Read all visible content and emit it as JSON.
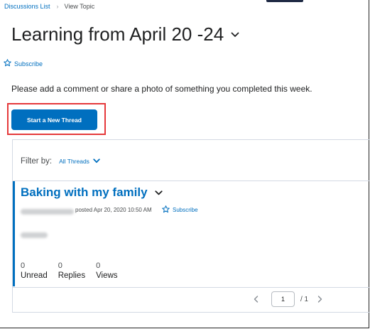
{
  "breadcrumb": {
    "parent": "Discussions List",
    "current": "View Topic"
  },
  "topic": {
    "title": "Learning from April 20 -24",
    "subscribe_label": "Subscribe",
    "instructions": "Please add a comment or share a photo of something you completed this week."
  },
  "actions": {
    "start_thread_label": "Start a New Thread"
  },
  "filter": {
    "label": "Filter by:",
    "value": "All Threads"
  },
  "thread": {
    "title": "Baking with my family",
    "posted": "posted Apr 20, 2020 10:50 AM",
    "subscribe_label": "Subscribe",
    "stats": [
      {
        "count": "0",
        "label": "Unread"
      },
      {
        "count": "0",
        "label": "Replies"
      },
      {
        "count": "0",
        "label": "Views"
      }
    ]
  },
  "pager": {
    "current_page": "1",
    "total": "/ 1"
  },
  "colors": {
    "link": "#006fbf",
    "highlight": "#e5393b",
    "accent": "#006fbf"
  }
}
